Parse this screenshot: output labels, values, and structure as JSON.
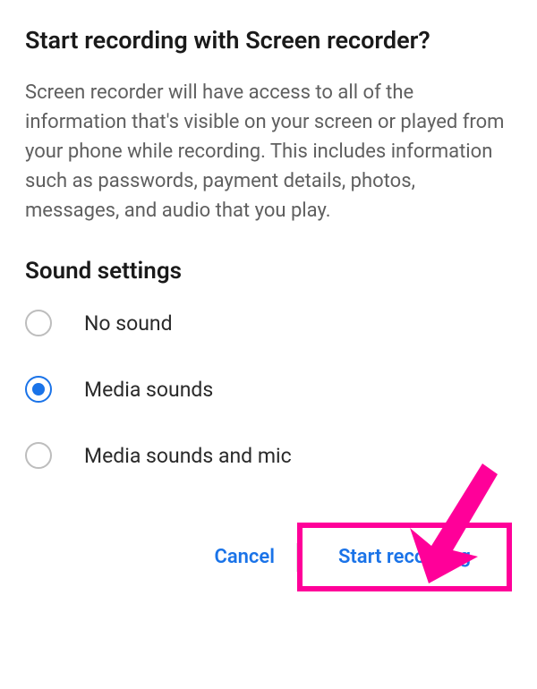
{
  "dialog": {
    "title": "Start recording with Screen recorder?",
    "body": "Screen recorder will have access to all of the information that's visible on your screen or played from your phone while recording. This includes information such as passwords, payment details, photos, messages, and audio that you play."
  },
  "sound_settings": {
    "heading": "Sound settings",
    "options": [
      {
        "label": "No sound",
        "selected": false
      },
      {
        "label": "Media sounds",
        "selected": true
      },
      {
        "label": "Media sounds and mic",
        "selected": false
      }
    ]
  },
  "buttons": {
    "cancel": "Cancel",
    "confirm": "Start recording"
  },
  "colors": {
    "accent": "#1a73e8",
    "annotation": "#ff0099"
  }
}
